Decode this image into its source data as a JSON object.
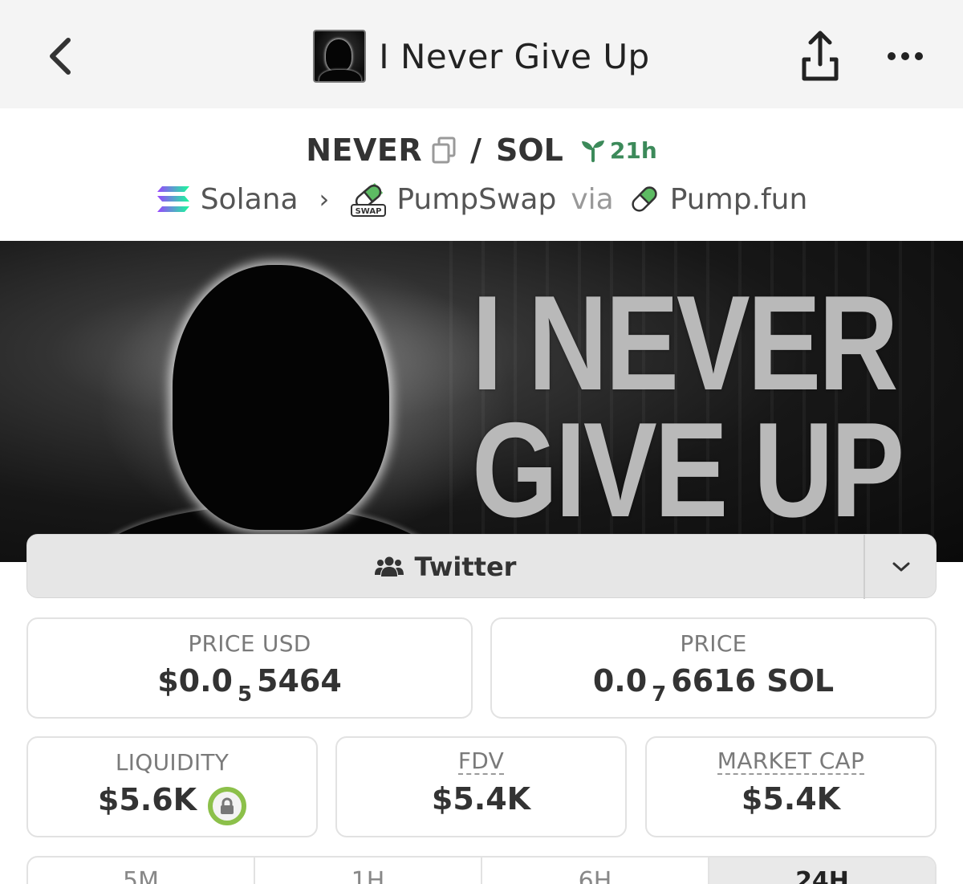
{
  "header": {
    "title": "I Never Give Up"
  },
  "pair": {
    "base": "NEVER",
    "separator": "/",
    "quote": "SOL",
    "age": "21h"
  },
  "chain": {
    "network": "Solana",
    "dex": "PumpSwap",
    "via": "via",
    "launchpad": "Pump.fun",
    "swap_badge": "SWAP"
  },
  "banner": {
    "line1": "I NEVER",
    "line2": "GIVE UP"
  },
  "socials": {
    "twitter_label": "Twitter"
  },
  "stats": {
    "price_usd": {
      "label": "PRICE USD",
      "prefix": "$0.0",
      "zeros": "5",
      "digits": "5464"
    },
    "price_native": {
      "label": "PRICE",
      "prefix": "0.0",
      "zeros": "7",
      "digits": "6616 SOL"
    },
    "liquidity": {
      "label": "LIQUIDITY",
      "value": "$5.6K"
    },
    "fdv": {
      "label": "FDV",
      "value": "$5.4K"
    },
    "market_cap": {
      "label": "MARKET CAP",
      "value": "$5.4K"
    }
  },
  "tabs": [
    {
      "label": "5M",
      "active": false
    },
    {
      "label": "1H",
      "active": false
    },
    {
      "label": "6H",
      "active": false
    },
    {
      "label": "24H",
      "active": true
    }
  ],
  "colors": {
    "age_green": "#3c8a5a",
    "lock_ring": "#8cc04a",
    "topbar_bg": "#f4f4f4"
  }
}
